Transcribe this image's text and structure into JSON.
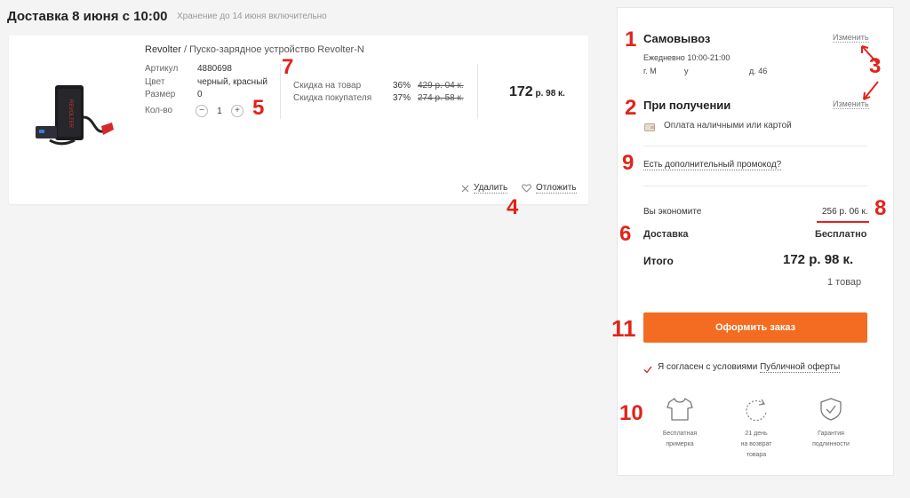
{
  "header": {
    "title": "Доставка 8 июня с 10:00",
    "subtitle": "Хранение до 14 июня включительно"
  },
  "product": {
    "brand": "Revolter",
    "separator": " / ",
    "name": "Пуско-зарядное устройство Revolter-N",
    "image_text": "REVOLTER",
    "specs": [
      {
        "label": "Артикул",
        "value": "4880698"
      },
      {
        "label": "Цвет",
        "value": "черный, красный"
      },
      {
        "label": "Размер",
        "value": "0"
      }
    ],
    "qty_label": "Кол-во",
    "qty": {
      "minus": "−",
      "value": "1",
      "plus": "+"
    },
    "discounts": [
      {
        "label": "Скидка на товар",
        "percent": "36%",
        "amount": "429 р. 04 к."
      },
      {
        "label": "Скидка покупателя",
        "percent": "37%",
        "amount": "274 р. 58 к."
      }
    ],
    "price_main": "172",
    "price_rest": " р. 98 к.",
    "delete_label": "Удалить",
    "postpone_label": "Отложить"
  },
  "panel": {
    "pickup_title": "Самовывоз",
    "pickup_hours": "Ежедневно 10:00-21:00",
    "pickup_address_start": "г. М",
    "pickup_address_mid": "у",
    "pickup_address_end": "д. 46",
    "change_label": "Изменить",
    "payment_title": "При получении",
    "payment_desc": "Оплата наличными или картой",
    "promo_link": "Есть дополнительный промокод?",
    "savings_label": "Вы экономите",
    "savings_value": "256 р. 06 к.",
    "delivery_label": "Доставка",
    "delivery_value": "Бесплатно",
    "total_label": "Итого",
    "total_value": "172 р. 98 к.",
    "items_count": "1 товар",
    "order_button": "Оформить заказ",
    "agree_text": "Я согласен с условиями ",
    "agree_link": "Публичной оферты",
    "features": [
      {
        "icon": "tshirt-icon",
        "line1": "Бесплатная",
        "line2": "примерка",
        "line3": ""
      },
      {
        "icon": "refresh-icon",
        "line1": "21 день",
        "line2": "на возврат",
        "line3": "товара"
      },
      {
        "icon": "shield-check-icon",
        "line1": "Гарантия",
        "line2": "подлинности",
        "line3": ""
      }
    ]
  },
  "annotations": [
    "1",
    "2",
    "3",
    "4",
    "5",
    "6",
    "7",
    "8",
    "9",
    "10",
    "11"
  ],
  "colors": {
    "accent": "#f36c21",
    "annotation": "#e2231a",
    "background": "#f4f4f4"
  }
}
